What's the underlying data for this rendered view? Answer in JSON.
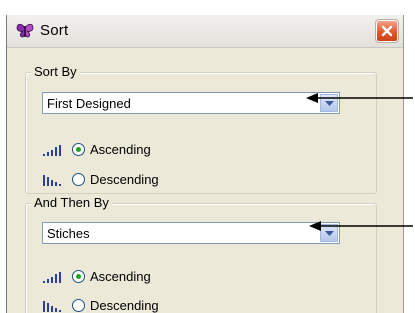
{
  "window": {
    "title": "Sort",
    "icon": "butterfly-app-icon",
    "close_icon": "close-icon"
  },
  "sort_by": {
    "legend": "Sort By",
    "selected": "First Designed",
    "options": {
      "ascending_label": "Ascending",
      "descending_label": "Descending",
      "selected": "Ascending"
    }
  },
  "then_by": {
    "legend": "And Then By",
    "selected": "Stiches",
    "options": {
      "ascending_label": "Ascending",
      "descending_label": "Descending",
      "selected": "Ascending"
    }
  },
  "colors": {
    "dialog_bg": "#ece9d8",
    "field_border": "#7f9db9",
    "close_button": "#e3572c",
    "radio_dot": "#21a121",
    "sort_icon": "#2b3f9f"
  }
}
